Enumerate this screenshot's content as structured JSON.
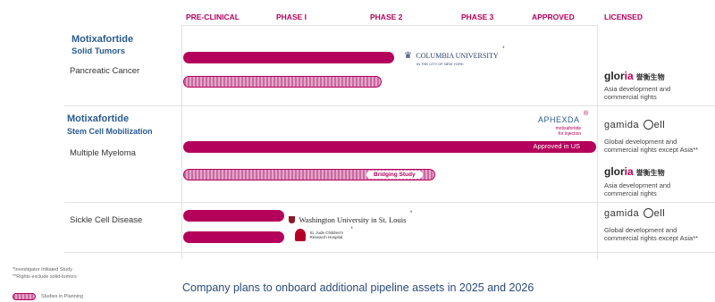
{
  "headers": [
    "PRE-CLINICAL",
    "PHASE I",
    "PHASE 2",
    "PHASE 3",
    "APPROVED",
    "LICENSED"
  ],
  "programs": [
    {
      "drug": "Motixafortide",
      "indication": "Solid Tumors"
    },
    {
      "drug": "Motixafortide",
      "indication": "Stem Cell Mobilization"
    }
  ],
  "diseases": [
    "Pancreatic Cancer",
    "Multiple Myeloma",
    "Sickle Cell Disease"
  ],
  "bars": [
    {
      "row": "pancreatic-1",
      "start_phase": "PRE-CLINICAL",
      "progress": 0.54,
      "status": "active"
    },
    {
      "row": "pancreatic-2",
      "start_phase": "PRE-CLINICAL",
      "progress": 0.52,
      "status": "planning"
    },
    {
      "row": "myeloma-1",
      "start_phase": "PRE-CLINICAL",
      "progress": 1.0,
      "status": "active",
      "label": "Approved in US"
    },
    {
      "row": "myeloma-2",
      "start_phase": "PRE-CLINICAL",
      "progress": 0.66,
      "status": "planning",
      "label": "Bridging Study"
    },
    {
      "row": "sickle-1",
      "start_phase": "PRE-CLINICAL",
      "progress": 0.25,
      "status": "active"
    },
    {
      "row": "sickle-2",
      "start_phase": "PRE-CLINICAL",
      "progress": 0.25,
      "status": "active"
    }
  ],
  "partners": {
    "columbia": {
      "name": "COLUMBIA UNIVERSITY",
      "sub": "IN THE CITY OF NEW YORK",
      "mark": "*"
    },
    "aphexda": {
      "name": "APHEXDA",
      "sub": "motixafortide",
      "sub2": "for injection",
      "mark": "®"
    },
    "washu": {
      "name": "Washington University in St. Louis",
      "mark": "*"
    },
    "stjude": {
      "name": "St. Jude Children's",
      "sub": "Research Hospital",
      "mark": "*"
    }
  },
  "licensees": [
    {
      "logo_a": "glor",
      "logo_b": "ia",
      "logo_cn": "誉衡生物",
      "desc": [
        "Asia development and",
        "commercial rights"
      ]
    },
    {
      "logo_a": "gamida ",
      "logo_b": "ell",
      "desc": [
        "Global development and",
        "commercial rights except Asia**"
      ]
    },
    {
      "logo_a": "glor",
      "logo_b": "ia",
      "logo_cn": "誉衡生物",
      "desc": [
        "Asia development and",
        "commercial rights"
      ]
    },
    {
      "logo_a": "gamida ",
      "logo_b": "ell",
      "desc": [
        "Global development and",
        "commercial rights except Asia**"
      ]
    }
  ],
  "footnotes": [
    "*Investigator Initiated Study",
    "**Rights exclude solid-tumors"
  ],
  "legend": {
    "label": "Studies in Planning"
  },
  "headline": "Company plans to onboard additional pipeline assets in 2025 and 2026",
  "colors": {
    "brand": "#b5005b",
    "title": "#2a5b8f"
  }
}
